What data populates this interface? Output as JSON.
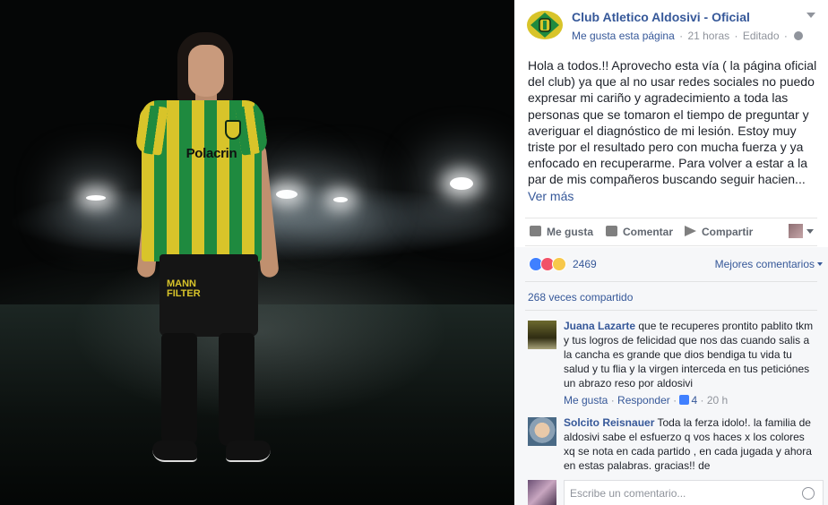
{
  "page": {
    "name": "Club Atletico Aldosivi - Oficial",
    "like_page": "Me gusta esta página",
    "time": "21 horas",
    "edited": "Editado",
    "dot": "·"
  },
  "post": {
    "text": "Hola a todos.!! Aprovecho esta vía ( la página oficial del club) ya que al no usar redes sociales no puedo expresar mi cariño y agradecimiento a toda las personas que se tomaron el tiempo de preguntar y averiguar el diagnóstico de mi lesión. Estoy muy triste por el resultado pero con mucha fuerza y ya enfocado en recuperarme. Para volver a estar a la par de mis compañeros buscando seguir hacien...",
    "see_more": "Ver más"
  },
  "photo": {
    "sponsor": "Polacrin",
    "shorts_sponsor_line1": "MANN",
    "shorts_sponsor_line2": "FILTER"
  },
  "actions": {
    "like": "Me gusta",
    "comment": "Comentar",
    "share": "Compartir"
  },
  "feedback": {
    "reactions_count": "2469",
    "sort": "Mejores comentarios",
    "shares": "268 veces compartido"
  },
  "comments": [
    {
      "name": "Juana Lazarte",
      "text": " que te recuperes prontito pablito tkm y tus logros de felicidad que nos das cuando salis a la cancha es grande que dios bendiga tu vida tu salud y tu flia y la virgen interceda en tus peticiónes un abrazo reso por aldosivi",
      "like": "Me gusta",
      "reply": "Responder",
      "likes": "4",
      "time": "20 h"
    },
    {
      "name": "Solcito Reisnauer",
      "text": " Toda la ferza idolo!. la familia de aldosivi sabe el esfuerzo q vos haces x los colores xq se nota en cada partido , en cada jugada y ahora en estas palabras. gracias!! de"
    }
  ],
  "composer": {
    "placeholder": "Escribe un comentario..."
  },
  "colors": {
    "link": "#365899",
    "text": "#1d2129",
    "muted": "#90949c",
    "jersey_yellow": "#d8c42a",
    "jersey_green": "#1f8a3f"
  }
}
